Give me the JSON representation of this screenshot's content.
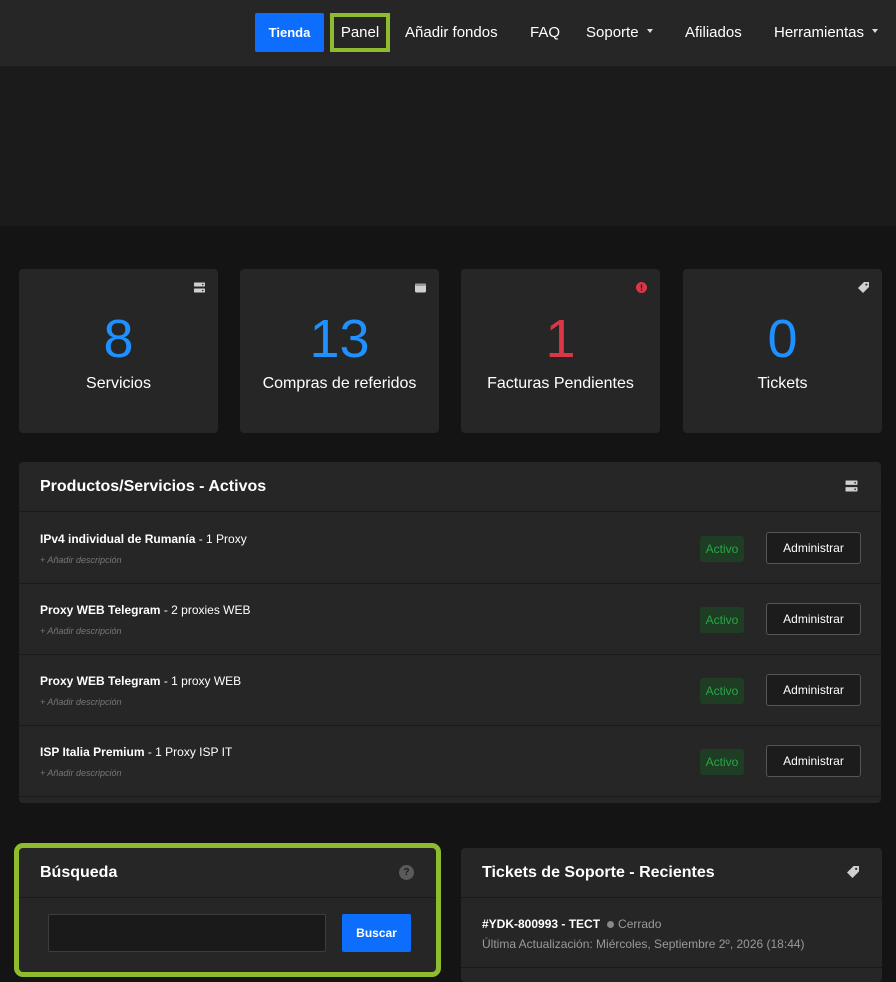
{
  "nav": {
    "tienda": "Tienda",
    "panel": "Panel",
    "add_funds": "Añadir fondos",
    "faq": "FAQ",
    "support": "Soporte",
    "affiliates": "Afiliados",
    "tools": "Herramientas"
  },
  "stats": [
    {
      "value": "8",
      "label": "Servicios",
      "icon": "server-icon"
    },
    {
      "value": "13",
      "label": "Compras de referidos",
      "icon": "wallet-icon"
    },
    {
      "value": "1",
      "label": "Facturas Pendientes",
      "icon": "alert-icon"
    },
    {
      "value": "0",
      "label": "Tickets",
      "icon": "tag-icon"
    }
  ],
  "products": {
    "title": "Productos/Servicios - Activos",
    "items": [
      {
        "name": "IPv4 individual de Rumanía",
        "detail": " - 1 Proxy",
        "desc": "+ Añadir descripción",
        "status": "Activo",
        "action": "Administrar"
      },
      {
        "name": "Proxy WEB Telegram",
        "detail": " - 2 proxies WEB",
        "desc": "+ Añadir descripción",
        "status": "Activo",
        "action": "Administrar"
      },
      {
        "name": "Proxy WEB Telegram",
        "detail": " - 1 proxy WEB",
        "desc": "+ Añadir descripción",
        "status": "Activo",
        "action": "Administrar"
      },
      {
        "name": "ISP Italia Premium",
        "detail": " - 1 Proxy ISP IT",
        "desc": "+ Añadir descripción",
        "status": "Activo",
        "action": "Administrar"
      }
    ]
  },
  "search": {
    "title": "Búsqueda",
    "help": "?",
    "value": "",
    "button": "Buscar"
  },
  "tickets": {
    "title": "Tickets de Soporte - Recientes",
    "items": [
      {
        "id": "#YDK-800993 - TECT",
        "status": "Cerrado",
        "updated": "Última Actualización: Miércoles, Septiembre 2º, 2026 (18:44)"
      }
    ]
  },
  "colors": {
    "accent": "#0d6efd",
    "highlight": "#8fbc2f",
    "stat_blue": "#1e90ff",
    "stat_red": "#dc3545",
    "active_green": "#28a745"
  }
}
